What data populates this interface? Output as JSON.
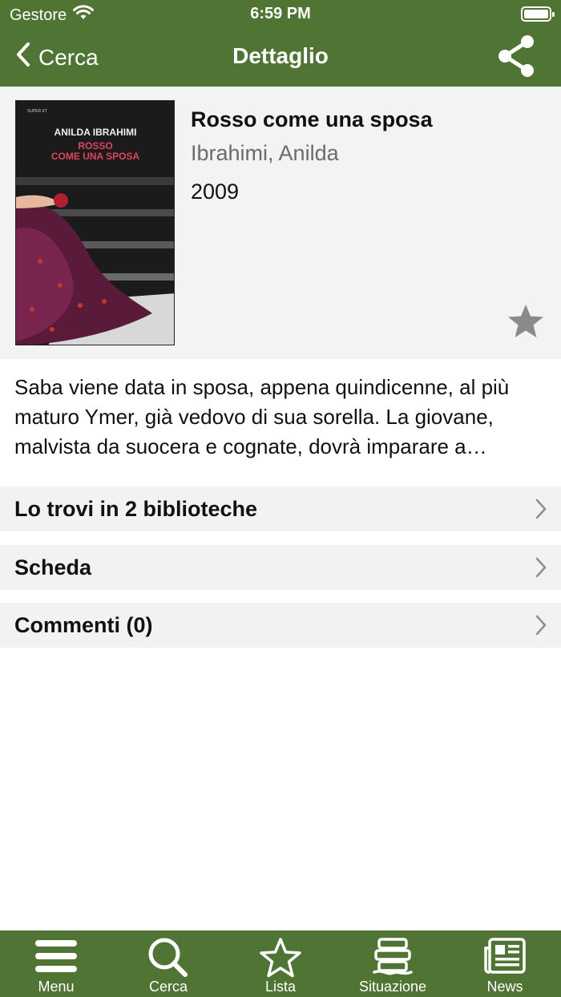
{
  "status_bar": {
    "carrier": "Gestore",
    "time": "6:59 PM"
  },
  "nav": {
    "back_label": "Cerca",
    "title": "Dettaglio"
  },
  "book": {
    "title": "Rosso come una sposa",
    "author": "Ibrahimi, Anilda",
    "year": "2009",
    "cover": {
      "series": "SUPER ET",
      "author_line": "ANILDA IBRAHIMI",
      "title_line1": "ROSSO",
      "title_line2": "COME UNA SPOSA"
    },
    "description": "Saba viene data in sposa, appena quindicenne, al più maturo Ymer, già vedovo di sua sorella. La giovane, malvista da suocera e cognate, dovrà imparare a difendersi e a conquistare il suo posto nella famiglia del marito."
  },
  "rows": [
    {
      "label": "Lo trovi in 2 biblioteche"
    },
    {
      "label": "Scheda"
    },
    {
      "label": "Commenti (0)"
    }
  ],
  "tabs": [
    {
      "label": "Menu",
      "icon": "menu-icon"
    },
    {
      "label": "Cerca",
      "icon": "search-icon"
    },
    {
      "label": "Lista",
      "icon": "star-outline-icon"
    },
    {
      "label": "Situazione",
      "icon": "books-stack-icon"
    },
    {
      "label": "News",
      "icon": "newspaper-icon"
    }
  ],
  "colors": {
    "accent": "#4f7434",
    "card_bg": "#f3f3f3",
    "row_bg": "#f2f2f2",
    "muted_text": "#6b6b6b",
    "star": "#8a8a8a"
  }
}
